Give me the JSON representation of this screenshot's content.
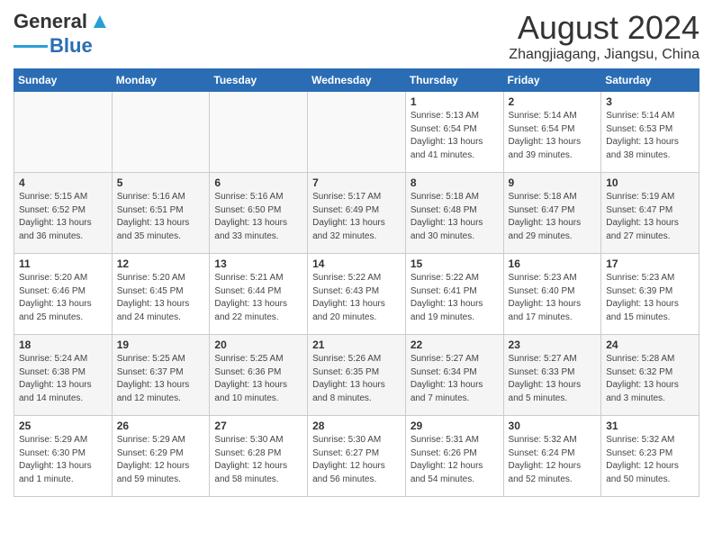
{
  "header": {
    "logo_general": "General",
    "logo_blue": "Blue",
    "month_year": "August 2024",
    "location": "Zhangjiagang, Jiangsu, China"
  },
  "days_of_week": [
    "Sunday",
    "Monday",
    "Tuesday",
    "Wednesday",
    "Thursday",
    "Friday",
    "Saturday"
  ],
  "weeks": [
    [
      {
        "day": "",
        "info": ""
      },
      {
        "day": "",
        "info": ""
      },
      {
        "day": "",
        "info": ""
      },
      {
        "day": "",
        "info": ""
      },
      {
        "day": "1",
        "info": "Sunrise: 5:13 AM\nSunset: 6:54 PM\nDaylight: 13 hours\nand 41 minutes."
      },
      {
        "day": "2",
        "info": "Sunrise: 5:14 AM\nSunset: 6:54 PM\nDaylight: 13 hours\nand 39 minutes."
      },
      {
        "day": "3",
        "info": "Sunrise: 5:14 AM\nSunset: 6:53 PM\nDaylight: 13 hours\nand 38 minutes."
      }
    ],
    [
      {
        "day": "4",
        "info": "Sunrise: 5:15 AM\nSunset: 6:52 PM\nDaylight: 13 hours\nand 36 minutes."
      },
      {
        "day": "5",
        "info": "Sunrise: 5:16 AM\nSunset: 6:51 PM\nDaylight: 13 hours\nand 35 minutes."
      },
      {
        "day": "6",
        "info": "Sunrise: 5:16 AM\nSunset: 6:50 PM\nDaylight: 13 hours\nand 33 minutes."
      },
      {
        "day": "7",
        "info": "Sunrise: 5:17 AM\nSunset: 6:49 PM\nDaylight: 13 hours\nand 32 minutes."
      },
      {
        "day": "8",
        "info": "Sunrise: 5:18 AM\nSunset: 6:48 PM\nDaylight: 13 hours\nand 30 minutes."
      },
      {
        "day": "9",
        "info": "Sunrise: 5:18 AM\nSunset: 6:47 PM\nDaylight: 13 hours\nand 29 minutes."
      },
      {
        "day": "10",
        "info": "Sunrise: 5:19 AM\nSunset: 6:47 PM\nDaylight: 13 hours\nand 27 minutes."
      }
    ],
    [
      {
        "day": "11",
        "info": "Sunrise: 5:20 AM\nSunset: 6:46 PM\nDaylight: 13 hours\nand 25 minutes."
      },
      {
        "day": "12",
        "info": "Sunrise: 5:20 AM\nSunset: 6:45 PM\nDaylight: 13 hours\nand 24 minutes."
      },
      {
        "day": "13",
        "info": "Sunrise: 5:21 AM\nSunset: 6:44 PM\nDaylight: 13 hours\nand 22 minutes."
      },
      {
        "day": "14",
        "info": "Sunrise: 5:22 AM\nSunset: 6:43 PM\nDaylight: 13 hours\nand 20 minutes."
      },
      {
        "day": "15",
        "info": "Sunrise: 5:22 AM\nSunset: 6:41 PM\nDaylight: 13 hours\nand 19 minutes."
      },
      {
        "day": "16",
        "info": "Sunrise: 5:23 AM\nSunset: 6:40 PM\nDaylight: 13 hours\nand 17 minutes."
      },
      {
        "day": "17",
        "info": "Sunrise: 5:23 AM\nSunset: 6:39 PM\nDaylight: 13 hours\nand 15 minutes."
      }
    ],
    [
      {
        "day": "18",
        "info": "Sunrise: 5:24 AM\nSunset: 6:38 PM\nDaylight: 13 hours\nand 14 minutes."
      },
      {
        "day": "19",
        "info": "Sunrise: 5:25 AM\nSunset: 6:37 PM\nDaylight: 13 hours\nand 12 minutes."
      },
      {
        "day": "20",
        "info": "Sunrise: 5:25 AM\nSunset: 6:36 PM\nDaylight: 13 hours\nand 10 minutes."
      },
      {
        "day": "21",
        "info": "Sunrise: 5:26 AM\nSunset: 6:35 PM\nDaylight: 13 hours\nand 8 minutes."
      },
      {
        "day": "22",
        "info": "Sunrise: 5:27 AM\nSunset: 6:34 PM\nDaylight: 13 hours\nand 7 minutes."
      },
      {
        "day": "23",
        "info": "Sunrise: 5:27 AM\nSunset: 6:33 PM\nDaylight: 13 hours\nand 5 minutes."
      },
      {
        "day": "24",
        "info": "Sunrise: 5:28 AM\nSunset: 6:32 PM\nDaylight: 13 hours\nand 3 minutes."
      }
    ],
    [
      {
        "day": "25",
        "info": "Sunrise: 5:29 AM\nSunset: 6:30 PM\nDaylight: 13 hours\nand 1 minute."
      },
      {
        "day": "26",
        "info": "Sunrise: 5:29 AM\nSunset: 6:29 PM\nDaylight: 12 hours\nand 59 minutes."
      },
      {
        "day": "27",
        "info": "Sunrise: 5:30 AM\nSunset: 6:28 PM\nDaylight: 12 hours\nand 58 minutes."
      },
      {
        "day": "28",
        "info": "Sunrise: 5:30 AM\nSunset: 6:27 PM\nDaylight: 12 hours\nand 56 minutes."
      },
      {
        "day": "29",
        "info": "Sunrise: 5:31 AM\nSunset: 6:26 PM\nDaylight: 12 hours\nand 54 minutes."
      },
      {
        "day": "30",
        "info": "Sunrise: 5:32 AM\nSunset: 6:24 PM\nDaylight: 12 hours\nand 52 minutes."
      },
      {
        "day": "31",
        "info": "Sunrise: 5:32 AM\nSunset: 6:23 PM\nDaylight: 12 hours\nand 50 minutes."
      }
    ]
  ]
}
